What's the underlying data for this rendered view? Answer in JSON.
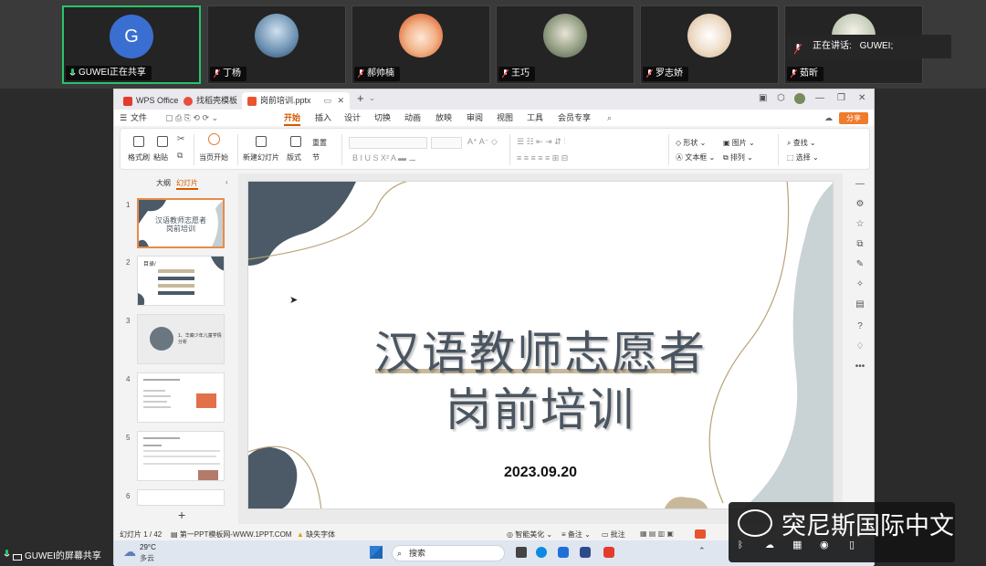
{
  "meeting": {
    "participants": [
      {
        "name": "GUWEI正在共享",
        "initial": "G",
        "color": "#3a6fd1",
        "active": true
      },
      {
        "name": "丁杨",
        "initial": "",
        "color": "#6a8fb0",
        "active": false
      },
      {
        "name": "郝帅楠",
        "initial": "",
        "color": "#e89b6d",
        "active": false
      },
      {
        "name": "王巧",
        "initial": "",
        "color": "#7d8a6a",
        "active": false
      },
      {
        "name": "罗志娇",
        "initial": "",
        "color": "#d9c3a9",
        "active": false
      },
      {
        "name": "茹昕",
        "initial": "",
        "color": "#bfc9b3",
        "active": false
      }
    ],
    "speaking_label": "正在讲话:",
    "speaking_name": "GUWEI;",
    "share_label": "GUWEI的屏幕共享"
  },
  "wps": {
    "tabs": [
      "WPS Office",
      "找稻壳模板",
      "岗前培训.pptx"
    ],
    "menu": [
      "文件",
      "开始",
      "插入",
      "设计",
      "切换",
      "动画",
      "放映",
      "审阅",
      "视图",
      "工具",
      "会员专享"
    ],
    "share": "分享",
    "ribbon": {
      "format_painter": "格式刷",
      "paste": "粘贴",
      "from_current": "当页开始",
      "new_slide": "新建幻灯片",
      "layout": "版式",
      "section": "节",
      "reset": "重置",
      "shape": "形状",
      "picture": "图片",
      "textbox": "文本框",
      "arrange": "排列",
      "find": "查找",
      "select": "选择"
    },
    "panel_tabs": [
      "大纲",
      "幻灯片"
    ],
    "thumb_numbers": [
      "1",
      "2",
      "3",
      "4",
      "5",
      "6"
    ],
    "thumb1_title": [
      "汉语教师志愿者",
      "岗前培训"
    ],
    "thumb2_title": "目录/",
    "thumb3_text": "1、华裔少年儿童学情分析",
    "slide": {
      "title_line1": "汉语教师志愿者",
      "title_line2": "岗前培训",
      "date": "2023.09.20"
    },
    "status": {
      "slide_count": "幻灯片 1 / 42",
      "template": "第一PPT模板网-WWW.1PPT.COM",
      "missing_font": "缺失字体",
      "beautify": "智能美化",
      "notes": "备注",
      "comments": "批注"
    }
  },
  "taskbar": {
    "temp": "29°C",
    "weather": "多云",
    "search": "搜索"
  },
  "watermark": "突尼斯国际中文"
}
